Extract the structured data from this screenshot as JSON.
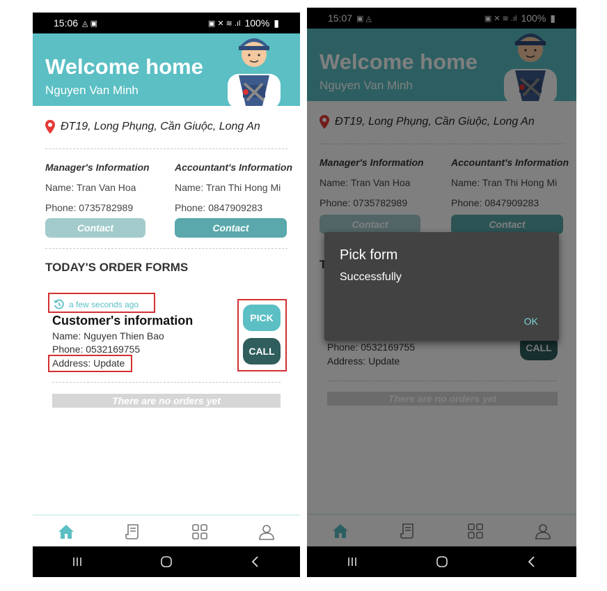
{
  "screens": [
    {
      "status": {
        "time": "15:06",
        "battery": "100%"
      }
    },
    {
      "status": {
        "time": "15:07",
        "battery": "100%"
      }
    }
  ],
  "header": {
    "welcome": "Welcome home",
    "username": "Nguyen Van Minh"
  },
  "location": "ĐT19, Long Phụng, Cần Giuộc, Long An",
  "manager": {
    "title": "Manager's Information",
    "name": "Name: Tran Van Hoa",
    "phone": "Phone: 0735782989",
    "contact_label": "Contact"
  },
  "accountant": {
    "title": "Accountant's Information",
    "name": "Name: Tran Thi Hong Mi",
    "phone": "Phone: 0847909283",
    "contact_label": "Contact"
  },
  "orders": {
    "section_title": "TODAY'S ORDER FORMS",
    "section_title_partial": "T",
    "item": {
      "time": "a few seconds ago",
      "title": "Customer's information",
      "name": "Name: Nguyen Thien Bao",
      "phone": "Phone: 0532169755",
      "address": "Address: Update",
      "pick_label": "PICK",
      "call_label": "CALL"
    },
    "empty_text": "There are no orders yet"
  },
  "dialog": {
    "title": "Pick form",
    "message": "Successfully",
    "ok_label": "OK"
  },
  "tabs": [
    "home",
    "orders",
    "apps",
    "profile"
  ],
  "colors": {
    "primary": "#5bbfc4",
    "contact_manager": "#a3cbcc",
    "contact_accountant": "#5aa8ab",
    "call": "#2f5e5c",
    "highlight": "#d32f2f",
    "location_pin": "#e53935"
  },
  "icons": {
    "location": "map-pin-icon",
    "time": "history-icon",
    "tab_home": "home-icon",
    "tab_orders": "receipt-icon",
    "tab_apps": "grid-icon",
    "tab_profile": "user-icon"
  }
}
